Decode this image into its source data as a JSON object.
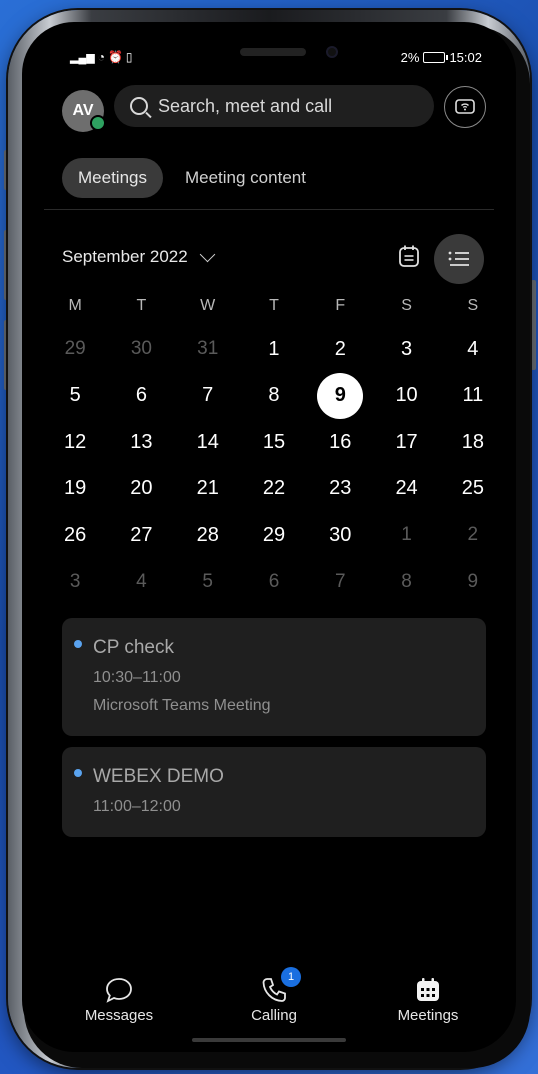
{
  "status_bar": {
    "signal_text": "all",
    "battery_text": "2%",
    "time": "15:02"
  },
  "header": {
    "avatar_initials": "AV",
    "search_placeholder": "Search, meet and call"
  },
  "tabs": [
    {
      "label": "Meetings",
      "active": true
    },
    {
      "label": "Meeting content",
      "active": false
    }
  ],
  "calendar": {
    "month_label": "September 2022",
    "weekdays": [
      "M",
      "T",
      "W",
      "T",
      "F",
      "S",
      "S"
    ],
    "weeks": [
      [
        {
          "d": "29",
          "m": true
        },
        {
          "d": "30",
          "m": true
        },
        {
          "d": "31",
          "m": true
        },
        {
          "d": "1"
        },
        {
          "d": "2"
        },
        {
          "d": "3"
        },
        {
          "d": "4"
        }
      ],
      [
        {
          "d": "5"
        },
        {
          "d": "6"
        },
        {
          "d": "7"
        },
        {
          "d": "8"
        },
        {
          "d": "9",
          "today": true
        },
        {
          "d": "10"
        },
        {
          "d": "11"
        }
      ],
      [
        {
          "d": "12"
        },
        {
          "d": "13"
        },
        {
          "d": "14"
        },
        {
          "d": "15"
        },
        {
          "d": "16"
        },
        {
          "d": "17"
        },
        {
          "d": "18"
        }
      ],
      [
        {
          "d": "19"
        },
        {
          "d": "20"
        },
        {
          "d": "21"
        },
        {
          "d": "22"
        },
        {
          "d": "23"
        },
        {
          "d": "24"
        },
        {
          "d": "25"
        }
      ],
      [
        {
          "d": "26"
        },
        {
          "d": "27"
        },
        {
          "d": "28"
        },
        {
          "d": "29"
        },
        {
          "d": "30"
        },
        {
          "d": "1",
          "m": true
        },
        {
          "d": "2",
          "m": true
        }
      ],
      [
        {
          "d": "3",
          "m": true
        },
        {
          "d": "4",
          "m": true
        },
        {
          "d": "5",
          "m": true
        },
        {
          "d": "6",
          "m": true
        },
        {
          "d": "7",
          "m": true
        },
        {
          "d": "8",
          "m": true
        },
        {
          "d": "9",
          "m": true
        }
      ]
    ]
  },
  "meetings": [
    {
      "title": "CP check",
      "time": "10:30–11:00",
      "location": "Microsoft Teams Meeting",
      "dot_color": "#5aa3ef"
    },
    {
      "title": "WEBEX DEMO",
      "time": "11:00–12:00",
      "dot_color": "#5aa3ef"
    }
  ],
  "bottom_nav": {
    "messages_label": "Messages",
    "calling_label": "Calling",
    "calling_badge": "1",
    "meetings_label": "Meetings"
  },
  "colors": {
    "accent": "#1a6fe0",
    "presence": "#2ea160",
    "meeting_dot": "#5aa3ef"
  }
}
